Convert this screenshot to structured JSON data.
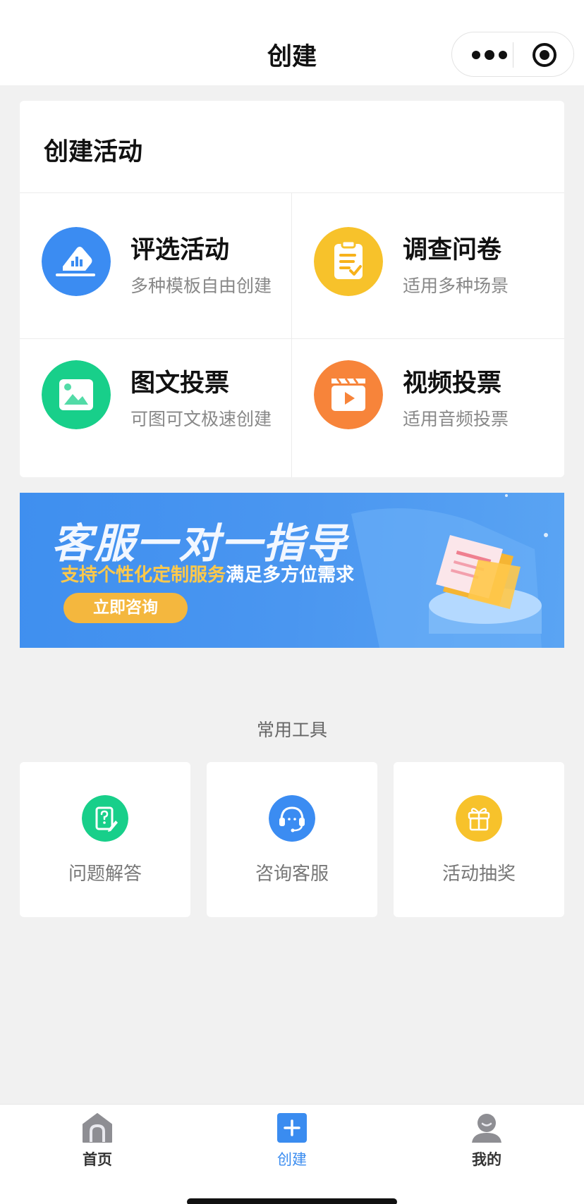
{
  "nav": {
    "title": "创建",
    "more_icon": "more-dots-icon",
    "close_icon": "target-circle-icon"
  },
  "create_section": {
    "title": "创建活动",
    "activities": [
      {
        "name": "评选活动",
        "desc": "多种模板自由创建",
        "icon": "vote-chart-icon",
        "color": "#3b8cf2"
      },
      {
        "name": "调查问卷",
        "desc": "适用多种场景",
        "icon": "clipboard-icon",
        "color": "#f7c22b"
      },
      {
        "name": "图文投票",
        "desc": "可图可文极速创建",
        "icon": "image-icon",
        "color": "#18cf8a"
      },
      {
        "name": "视频投票",
        "desc": "适用音频投票",
        "icon": "video-clapper-icon",
        "color": "#f7843a"
      }
    ]
  },
  "banner": {
    "title": "客服一对一指导",
    "subtitle_highlight": "支持个性化定制服务",
    "subtitle_rest": "满足多方位需求",
    "button": "立即咨询"
  },
  "tools": {
    "title": "常用工具",
    "items": [
      {
        "label": "问题解答",
        "icon": "question-note-icon",
        "color": "#18cf8a"
      },
      {
        "label": "咨询客服",
        "icon": "headset-icon",
        "color": "#3b8cf2"
      },
      {
        "label": "活动抽奖",
        "icon": "gift-icon",
        "color": "#f7c22b"
      }
    ]
  },
  "tabbar": {
    "items": [
      {
        "label": "首页",
        "icon": "home-icon",
        "active": false
      },
      {
        "label": "创建",
        "icon": "plus-icon",
        "active": true
      },
      {
        "label": "我的",
        "icon": "user-icon",
        "active": false
      }
    ],
    "active_color": "#3a8cf0"
  }
}
